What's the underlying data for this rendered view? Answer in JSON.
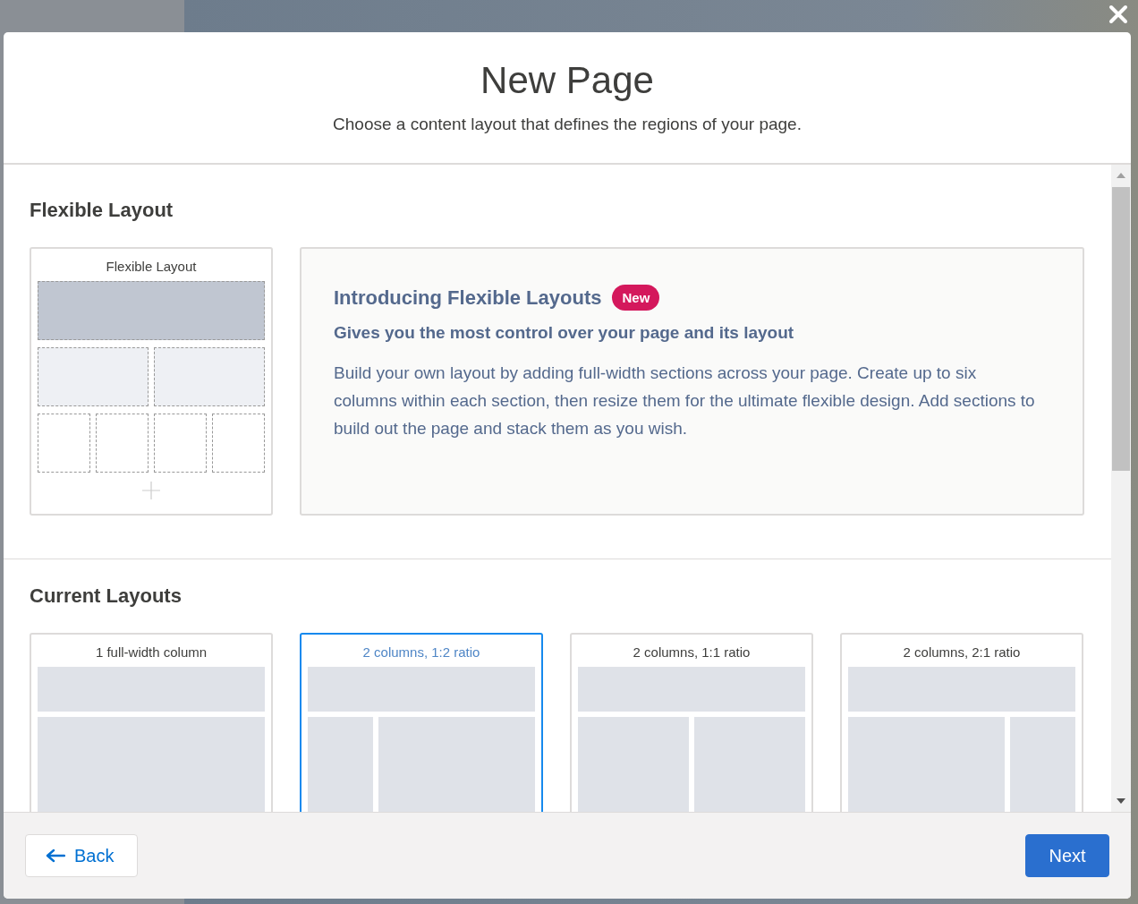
{
  "modal": {
    "title": "New Page",
    "subtitle": "Choose a content layout that defines the regions of your page."
  },
  "flexible_section": {
    "heading": "Flexible Layout",
    "card": {
      "label": "Flexible Layout"
    },
    "intro": {
      "title": "Introducing Flexible Layouts",
      "badge": "New",
      "subtitle": "Gives you the most control over your page and its layout",
      "body": "Build your own layout by adding full-width sections across your page. Create up to six columns within each section, then resize them for the ultimate flexible design. Add sections to build out the page and stack them as you wish."
    }
  },
  "current_section": {
    "heading": "Current Layouts",
    "layouts": [
      {
        "label": "1 full-width column",
        "kind": "full",
        "selected": false
      },
      {
        "label": "2 columns, 1:2 ratio",
        "kind": "one-two",
        "selected": true
      },
      {
        "label": "2 columns, 1:1 ratio",
        "kind": "one-one",
        "selected": false
      },
      {
        "label": "2 columns, 2:1 ratio",
        "kind": "two-one",
        "selected": false
      }
    ]
  },
  "footer": {
    "back": "Back",
    "next": "Next"
  }
}
